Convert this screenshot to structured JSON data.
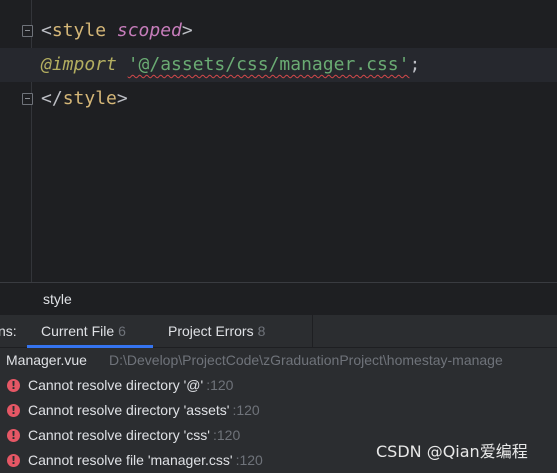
{
  "editor": {
    "line1": {
      "open": "<",
      "tag": "style",
      "attr": "scoped",
      "close": ">"
    },
    "line2": {
      "keyword": "@import",
      "string": "'@/assets/css/manager.css'",
      "semicolon": ";"
    },
    "line3": {
      "open": "</",
      "tag": "style",
      "close": ">"
    }
  },
  "breadcrumb": {
    "item": "style"
  },
  "problems": {
    "tab_prefix": "ns:",
    "tabs": [
      {
        "label": "Current File",
        "count": "6"
      },
      {
        "label": "Project Errors",
        "count": "8"
      }
    ],
    "file": {
      "name": "Manager.vue",
      "path": "D:\\Develop\\ProjectCode\\zGraduationProject\\homestay-manage"
    },
    "errors": [
      {
        "message": "Cannot resolve directory '@'",
        "location": ":120"
      },
      {
        "message": "Cannot resolve directory 'assets'",
        "location": ":120"
      },
      {
        "message": "Cannot resolve directory 'css'",
        "location": ":120"
      },
      {
        "message": "Cannot resolve file 'manager.css'",
        "location": ":120"
      }
    ]
  },
  "watermark": "CSDN @Qian爱编程",
  "colors": {
    "editor_bg": "#1e1f22",
    "panel_bg": "#2b2d30",
    "tag": "#d5b778",
    "attr": "#c77dbb",
    "keyword": "#b3ae60",
    "string": "#6aab73",
    "error": "#e55765",
    "accent": "#3574f0"
  }
}
